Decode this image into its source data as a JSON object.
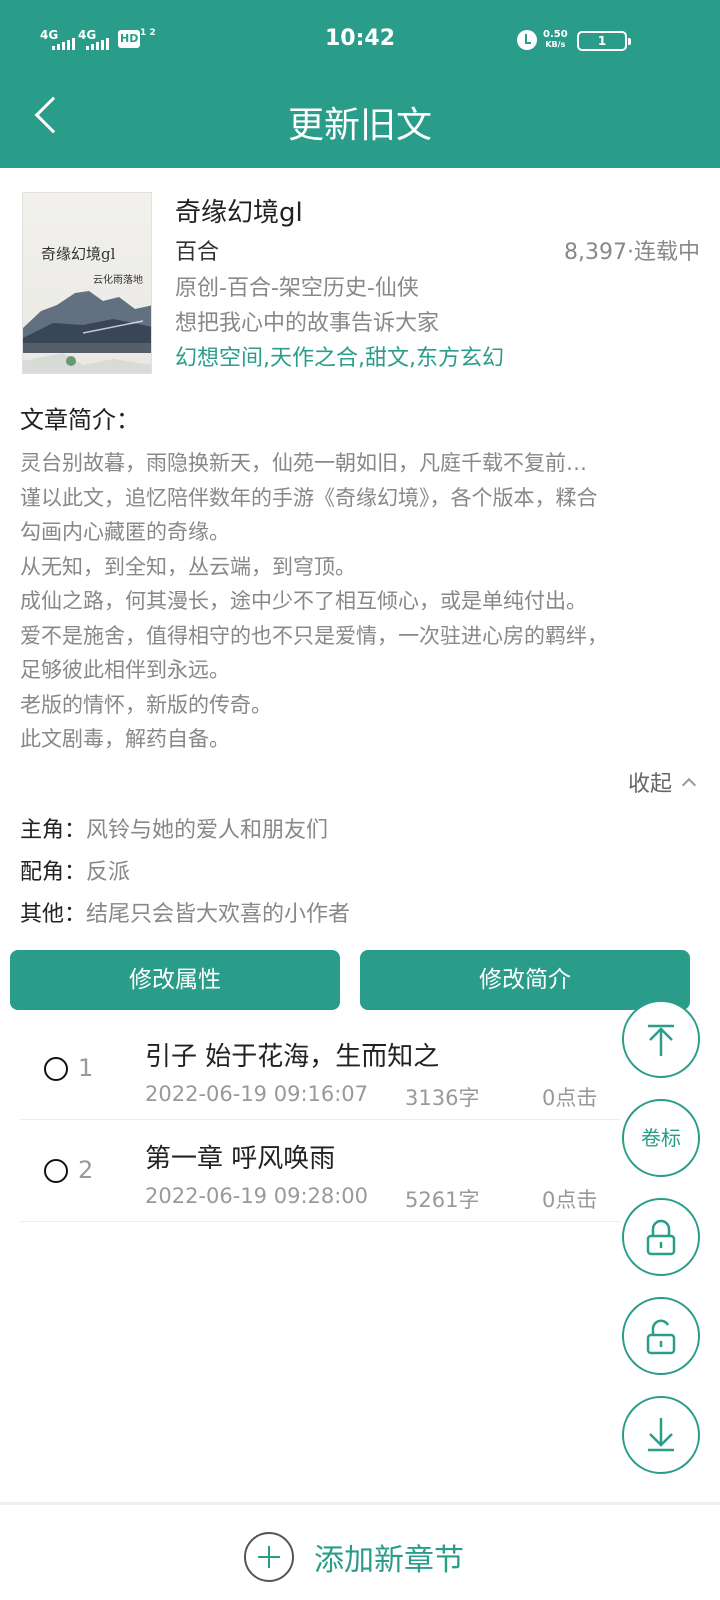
{
  "status_bar": {
    "network1": "4G",
    "network2": "4G",
    "hd": "HD",
    "sim_slots": "1 2",
    "time": "10:42",
    "speed_value": "0.50",
    "speed_unit": "KB/s",
    "battery": "1"
  },
  "header": {
    "title": "更新旧文"
  },
  "book": {
    "cover_title": "奇缘幻境gl",
    "cover_author": "云化雨落地",
    "title": "奇缘幻境gl",
    "category": "百合",
    "stats": "8,397·连载中",
    "genre": "原创-百合-架空历史-仙侠",
    "slogan": "想把我心中的故事告诉大家",
    "tags": "幻想空间,天作之合,甜文,东方玄幻"
  },
  "synopsis": {
    "heading": "文章简介：",
    "lines": [
      "灵台别故暮，雨隐换新天，仙苑一朝如旧，凡庭千载不复前…",
      "谨以此文，追忆陪伴数年的手游《奇缘幻境》，各个版本，糅合",
      "勾画内心藏匿的奇缘。",
      "从无知，到全知，丛云端，到穹顶。",
      "成仙之路，何其漫长，途中少不了相互倾心，或是单纯付出。",
      "爱不是施舍，值得相守的也不只是爱情，一次驻进心房的羁绊，",
      "足够彼此相伴到永远。",
      "老版的情怀，新版的传奇。",
      "此文剧毒，解药自备。"
    ],
    "collapse_label": "收起"
  },
  "roles": {
    "main_key": "主角：",
    "main_value": "风铃与她的爱人和朋友们",
    "support_key": "配角：",
    "support_value": "反派",
    "other_key": "其他：",
    "other_value": "结尾只会皆大欢喜的小作者"
  },
  "actions": {
    "edit_attributes": "修改属性",
    "edit_synopsis": "修改简介"
  },
  "chapters": [
    {
      "num": "1",
      "title": "引子 始于花海，生而知之",
      "date": "2022-06-19 09:16:07",
      "words": "3136字",
      "clicks": "0点击"
    },
    {
      "num": "2",
      "title": "第一章 呼风唤雨",
      "date": "2022-06-19 09:28:00",
      "words": "5261字",
      "clicks": "0点击"
    }
  ],
  "floating": {
    "volume_label": "卷标"
  },
  "bottom": {
    "add_chapter": "添加新章节"
  },
  "colors": {
    "primary": "#2a9d8a",
    "muted_text": "#888888",
    "dark_text": "#222222"
  }
}
